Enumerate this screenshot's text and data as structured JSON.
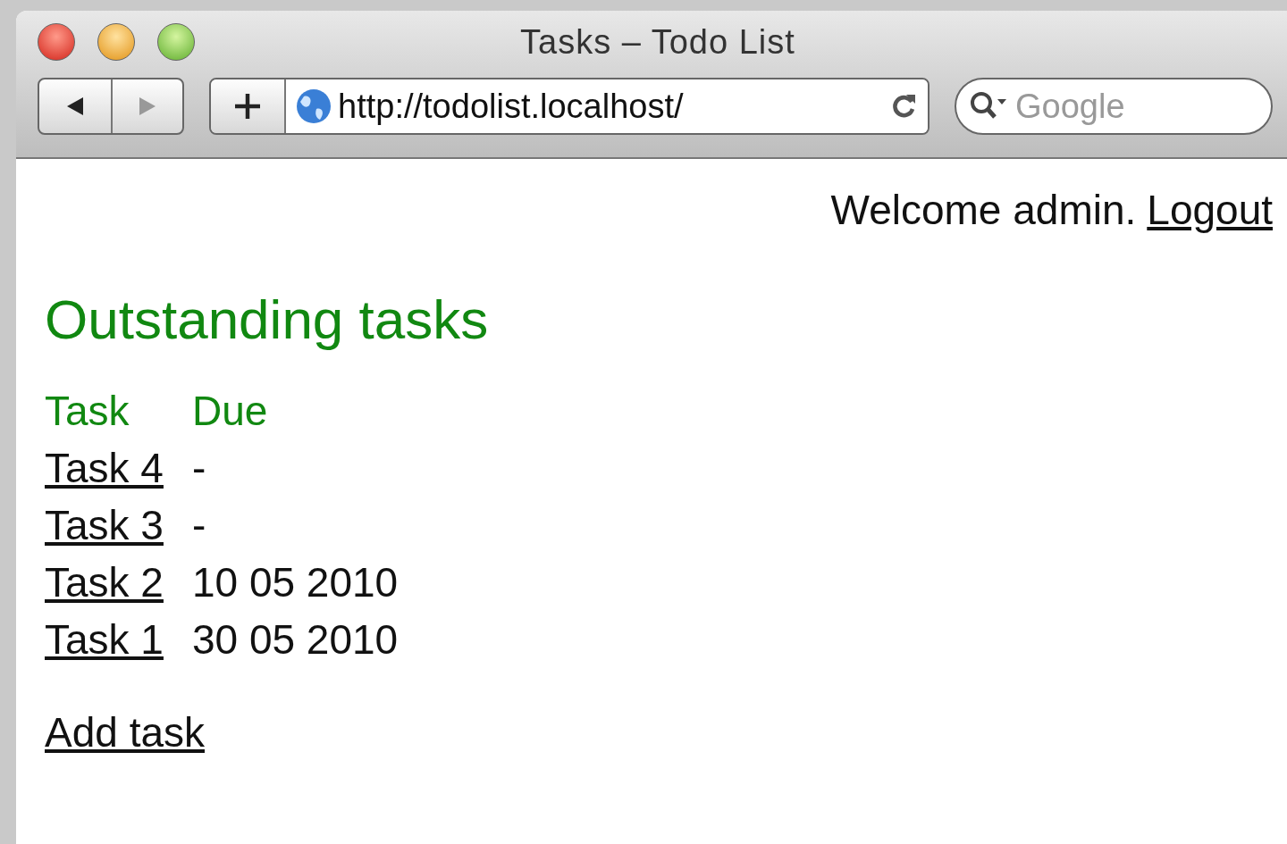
{
  "window": {
    "title": "Tasks – Todo List"
  },
  "toolbar": {
    "nav_buttons": [
      {
        "kind": "back",
        "disabled": false
      },
      {
        "kind": "forward",
        "disabled": true
      }
    ],
    "url": "http://todolist.localhost/",
    "search": {
      "placeholder": "Google"
    }
  },
  "header": {
    "welcome": "Welcome admin.",
    "logout": "Logout"
  },
  "heading": "Outstanding tasks",
  "table": {
    "columns": [
      "Task",
      "Due"
    ],
    "rows": [
      {
        "task": "Task 4",
        "due": "-"
      },
      {
        "task": "Task 3",
        "due": "-"
      },
      {
        "task": "Task 2",
        "due": "10 05 2010"
      },
      {
        "task": "Task 1",
        "due": "30 05 2010"
      }
    ]
  },
  "add_task": "Add task"
}
